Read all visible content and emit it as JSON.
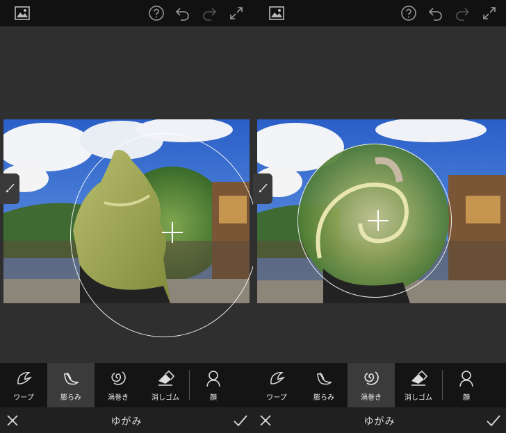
{
  "screens": [
    {
      "id": "left",
      "active_tool": "bulge",
      "tools": [
        {
          "key": "warp",
          "label": "ワープ",
          "icon": "warp-icon"
        },
        {
          "key": "bulge",
          "label": "膨らみ",
          "icon": "bulge-icon"
        },
        {
          "key": "swirl",
          "label": "渦巻き",
          "icon": "swirl-icon"
        },
        {
          "key": "eraser",
          "label": "消しゴム",
          "icon": "eraser-icon"
        },
        {
          "key": "face",
          "label": "顔",
          "icon": "face-icon"
        }
      ],
      "title": "ゆがみ"
    },
    {
      "id": "right",
      "active_tool": "swirl",
      "tools": [
        {
          "key": "warp",
          "label": "ワープ",
          "icon": "warp-icon"
        },
        {
          "key": "bulge",
          "label": "膨らみ",
          "icon": "bulge-icon"
        },
        {
          "key": "swirl",
          "label": "渦巻き",
          "icon": "swirl-icon"
        },
        {
          "key": "eraser",
          "label": "消しゴム",
          "icon": "eraser-icon"
        },
        {
          "key": "face",
          "label": "顔",
          "icon": "face-icon"
        }
      ],
      "title": "ゆがみ"
    }
  ],
  "topbar_icons": [
    "image-gallery-icon",
    "help-icon",
    "undo-icon",
    "redo-icon",
    "fullscreen-icon"
  ],
  "colors": {
    "accent_active_bg": "#3b3b3b",
    "topbar_bg": "#111111",
    "toolbar_bg": "#141414"
  }
}
